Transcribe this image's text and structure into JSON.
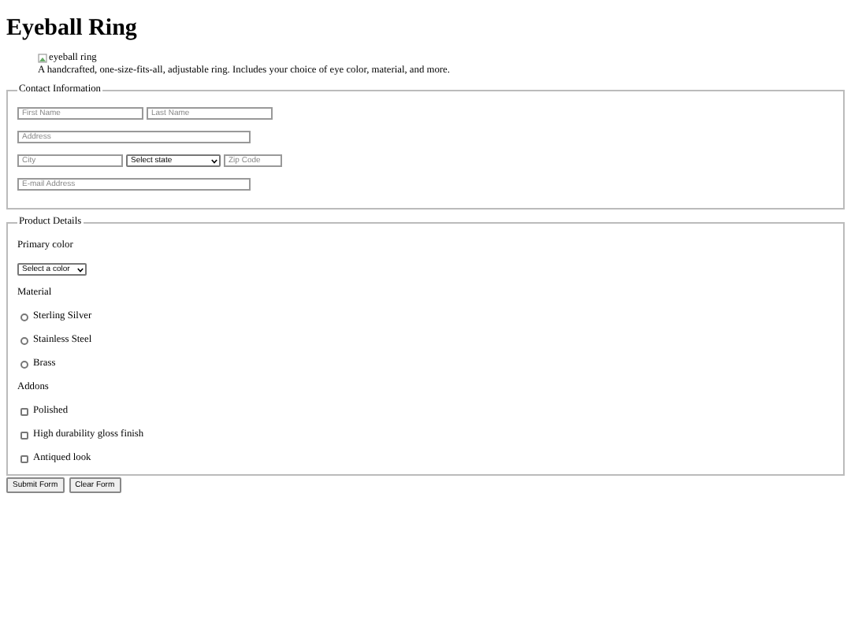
{
  "title": "Eyeball Ring",
  "image": {
    "alt": "eyeball ring"
  },
  "description": "A handcrafted, one-size-fits-all, adjustable ring. Includes your choice of eye color, material, and more.",
  "contact": {
    "legend": "Contact Information",
    "first_name": {
      "placeholder": "First Name"
    },
    "last_name": {
      "placeholder": "Last Name"
    },
    "address": {
      "placeholder": "Address"
    },
    "city": {
      "placeholder": "City"
    },
    "state": {
      "value": "Select state"
    },
    "zip": {
      "placeholder": "Zip Code"
    },
    "email": {
      "placeholder": "E-mail Address"
    }
  },
  "product": {
    "legend": "Product Details",
    "color_label": "Primary color",
    "color_select": {
      "value": "Select a color"
    },
    "material_label": "Material",
    "materials": [
      {
        "label": "Sterling Silver",
        "selected": false
      },
      {
        "label": "Stainless Steel",
        "selected": false
      },
      {
        "label": "Brass",
        "selected": false
      }
    ],
    "addons_label": "Addons",
    "addons": [
      {
        "label": "Polished",
        "checked": false
      },
      {
        "label": "High durability gloss finish",
        "checked": false
      },
      {
        "label": "Antiqued look",
        "checked": false
      }
    ]
  },
  "buttons": [
    "Submit Form",
    "Clear Form"
  ]
}
